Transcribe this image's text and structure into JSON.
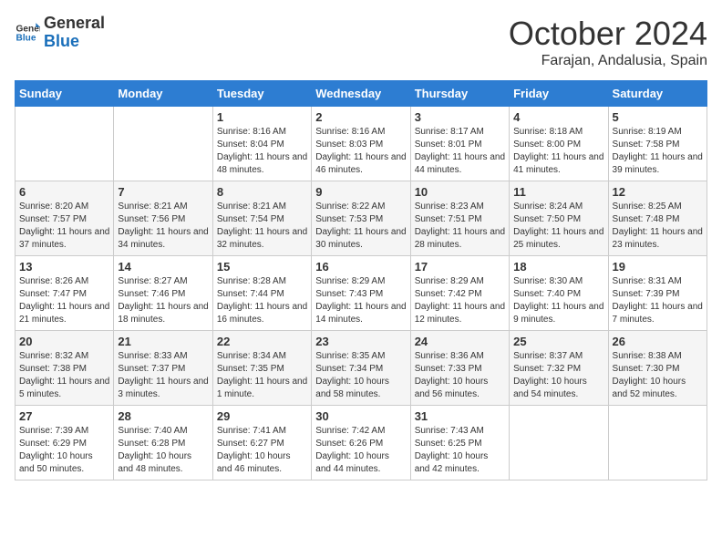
{
  "header": {
    "logo_line1": "General",
    "logo_line2": "Blue",
    "month_title": "October 2024",
    "location": "Farajan, Andalusia, Spain"
  },
  "weekdays": [
    "Sunday",
    "Monday",
    "Tuesday",
    "Wednesday",
    "Thursday",
    "Friday",
    "Saturday"
  ],
  "weeks": [
    [
      {
        "day": "",
        "info": ""
      },
      {
        "day": "",
        "info": ""
      },
      {
        "day": "1",
        "info": "Sunrise: 8:16 AM\nSunset: 8:04 PM\nDaylight: 11 hours and 48 minutes."
      },
      {
        "day": "2",
        "info": "Sunrise: 8:16 AM\nSunset: 8:03 PM\nDaylight: 11 hours and 46 minutes."
      },
      {
        "day": "3",
        "info": "Sunrise: 8:17 AM\nSunset: 8:01 PM\nDaylight: 11 hours and 44 minutes."
      },
      {
        "day": "4",
        "info": "Sunrise: 8:18 AM\nSunset: 8:00 PM\nDaylight: 11 hours and 41 minutes."
      },
      {
        "day": "5",
        "info": "Sunrise: 8:19 AM\nSunset: 7:58 PM\nDaylight: 11 hours and 39 minutes."
      }
    ],
    [
      {
        "day": "6",
        "info": "Sunrise: 8:20 AM\nSunset: 7:57 PM\nDaylight: 11 hours and 37 minutes."
      },
      {
        "day": "7",
        "info": "Sunrise: 8:21 AM\nSunset: 7:56 PM\nDaylight: 11 hours and 34 minutes."
      },
      {
        "day": "8",
        "info": "Sunrise: 8:21 AM\nSunset: 7:54 PM\nDaylight: 11 hours and 32 minutes."
      },
      {
        "day": "9",
        "info": "Sunrise: 8:22 AM\nSunset: 7:53 PM\nDaylight: 11 hours and 30 minutes."
      },
      {
        "day": "10",
        "info": "Sunrise: 8:23 AM\nSunset: 7:51 PM\nDaylight: 11 hours and 28 minutes."
      },
      {
        "day": "11",
        "info": "Sunrise: 8:24 AM\nSunset: 7:50 PM\nDaylight: 11 hours and 25 minutes."
      },
      {
        "day": "12",
        "info": "Sunrise: 8:25 AM\nSunset: 7:48 PM\nDaylight: 11 hours and 23 minutes."
      }
    ],
    [
      {
        "day": "13",
        "info": "Sunrise: 8:26 AM\nSunset: 7:47 PM\nDaylight: 11 hours and 21 minutes."
      },
      {
        "day": "14",
        "info": "Sunrise: 8:27 AM\nSunset: 7:46 PM\nDaylight: 11 hours and 18 minutes."
      },
      {
        "day": "15",
        "info": "Sunrise: 8:28 AM\nSunset: 7:44 PM\nDaylight: 11 hours and 16 minutes."
      },
      {
        "day": "16",
        "info": "Sunrise: 8:29 AM\nSunset: 7:43 PM\nDaylight: 11 hours and 14 minutes."
      },
      {
        "day": "17",
        "info": "Sunrise: 8:29 AM\nSunset: 7:42 PM\nDaylight: 11 hours and 12 minutes."
      },
      {
        "day": "18",
        "info": "Sunrise: 8:30 AM\nSunset: 7:40 PM\nDaylight: 11 hours and 9 minutes."
      },
      {
        "day": "19",
        "info": "Sunrise: 8:31 AM\nSunset: 7:39 PM\nDaylight: 11 hours and 7 minutes."
      }
    ],
    [
      {
        "day": "20",
        "info": "Sunrise: 8:32 AM\nSunset: 7:38 PM\nDaylight: 11 hours and 5 minutes."
      },
      {
        "day": "21",
        "info": "Sunrise: 8:33 AM\nSunset: 7:37 PM\nDaylight: 11 hours and 3 minutes."
      },
      {
        "day": "22",
        "info": "Sunrise: 8:34 AM\nSunset: 7:35 PM\nDaylight: 11 hours and 1 minute."
      },
      {
        "day": "23",
        "info": "Sunrise: 8:35 AM\nSunset: 7:34 PM\nDaylight: 10 hours and 58 minutes."
      },
      {
        "day": "24",
        "info": "Sunrise: 8:36 AM\nSunset: 7:33 PM\nDaylight: 10 hours and 56 minutes."
      },
      {
        "day": "25",
        "info": "Sunrise: 8:37 AM\nSunset: 7:32 PM\nDaylight: 10 hours and 54 minutes."
      },
      {
        "day": "26",
        "info": "Sunrise: 8:38 AM\nSunset: 7:30 PM\nDaylight: 10 hours and 52 minutes."
      }
    ],
    [
      {
        "day": "27",
        "info": "Sunrise: 7:39 AM\nSunset: 6:29 PM\nDaylight: 10 hours and 50 minutes."
      },
      {
        "day": "28",
        "info": "Sunrise: 7:40 AM\nSunset: 6:28 PM\nDaylight: 10 hours and 48 minutes."
      },
      {
        "day": "29",
        "info": "Sunrise: 7:41 AM\nSunset: 6:27 PM\nDaylight: 10 hours and 46 minutes."
      },
      {
        "day": "30",
        "info": "Sunrise: 7:42 AM\nSunset: 6:26 PM\nDaylight: 10 hours and 44 minutes."
      },
      {
        "day": "31",
        "info": "Sunrise: 7:43 AM\nSunset: 6:25 PM\nDaylight: 10 hours and 42 minutes."
      },
      {
        "day": "",
        "info": ""
      },
      {
        "day": "",
        "info": ""
      }
    ]
  ]
}
